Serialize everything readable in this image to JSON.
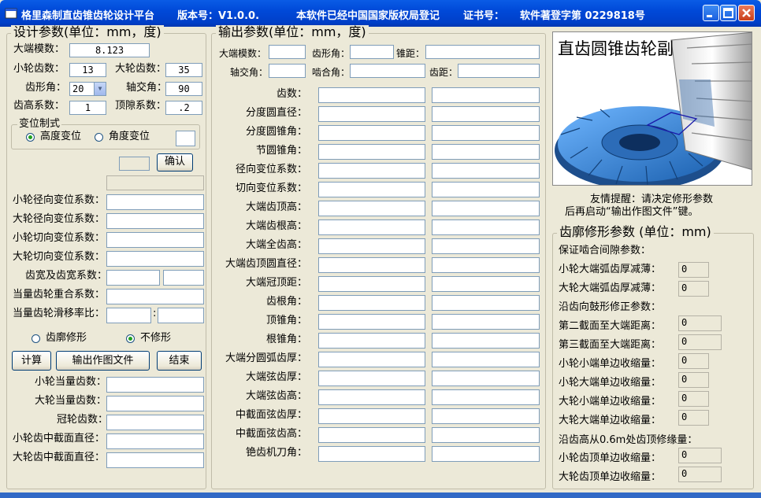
{
  "title": {
    "app": "格里森制直齿锥齿轮设计平台",
    "version_label": "版本号：V1.0.0.",
    "reg_label": "本软件已经中国国家版权局登记",
    "cert_label": "证书号：",
    "cert_value": "软件著登字第 0229818号"
  },
  "design": {
    "group_title": "设计参数(单位：mm，度)",
    "module_label": "大端模数：",
    "module_value": "8.123",
    "z1_label": "小轮齿数：",
    "z1_value": "13",
    "z2_label": "大轮齿数：",
    "z2_value": "35",
    "pa_label": "齿形角：",
    "pa_value": "20",
    "sa_label": "轴交角：",
    "sa_value": "90",
    "ha_label": "齿高系数：",
    "ha_value": "1",
    "c_label": "顶隙系数：",
    "c_value": ".2",
    "shift_group": "变位制式",
    "shift_h": "高度变位",
    "shift_a": "角度变位",
    "confirm": "确认",
    "x1_label": "小轮径向变位系数：",
    "x2_label": "大轮径向变位系数：",
    "xt1_label": "小轮切向变位系数：",
    "xt2_label": "大轮切向变位系数：",
    "face_label": "齿宽及齿宽系数：",
    "eps_label": "当量齿轮重合系数：",
    "slide_label": "当量齿轮滑移率比：",
    "mod_yes": "齿廓修形",
    "mod_no": "不修形",
    "btn_calc": "计算",
    "btn_export": "输出作图文件",
    "btn_end": "结束",
    "zv1_label": "小轮当量齿数：",
    "zv2_label": "大轮当量齿数：",
    "zc_label": "冠轮齿数：",
    "dm1_label": "小轮齿中截面直径：",
    "dm2_label": "大轮齿中截面直径："
  },
  "output": {
    "group_title": "输出参数(单位：mm，度)",
    "top": {
      "module": "大端模数：",
      "pa": "齿形角：",
      "cone": "锥距：",
      "shaft": "轴交角：",
      "mesh": "啮合角：",
      "pitch": "齿距："
    },
    "rows": [
      "齿数：",
      "分度圆直径：",
      "分度圆锥角：",
      "节圆锥角：",
      "径向变位系数：",
      "切向变位系数：",
      "大端齿顶高：",
      "大端齿根高：",
      "大端全齿高：",
      "大端齿顶圆直径：",
      "大端冠顶距：",
      "齿根角：",
      "顶锥角：",
      "根锥角：",
      "大端分圆弧齿厚：",
      "大端弦齿厚：",
      "大端弦齿高：",
      "中截面弦齿厚：",
      "中截面弦齿高：",
      "铯齿机刀角："
    ]
  },
  "picture": {
    "caption": "直齿圆锥齿轮副",
    "gear_color": "#3a8fd8"
  },
  "tip": {
    "line1": "友情提醒：请决定修形参数",
    "line2": "后再启动“输出作图文件”键。"
  },
  "profile": {
    "group_title": "齿廓修形参数 (单位：mm)",
    "clearance_head": "保证啮合间隙参数：",
    "small_thin": "小轮大端弧齿厚减薄：",
    "small_thin_value": "0",
    "big_thin": "大轮大端弧齿厚减薄：",
    "big_thin_value": "0",
    "crown_head": "沿齿向鼓形修正参数：",
    "sec2": "第二截面至大端距离：",
    "sec2_value": "0",
    "sec3": "第三截面至大端距离：",
    "sec3_value": "0",
    "s_small_end": "小轮小端单边收缩量：",
    "s_small_end_value": "0",
    "s_big_end": "小轮大端单边收缩量：",
    "s_big_end_value": "0",
    "b_small_end": "大轮小端单边收缩量：",
    "b_small_end_value": "0",
    "b_big_end": "大轮大端单边收缩量：",
    "b_big_end_value": "0",
    "tip_head": "沿齿高从0.6m处齿顶修缘量：",
    "tip_small": "小轮齿顶单边收缩量：",
    "tip_small_value": "0",
    "tip_big": "大轮齿顶单边收缩量：",
    "tip_big_value": "0"
  }
}
